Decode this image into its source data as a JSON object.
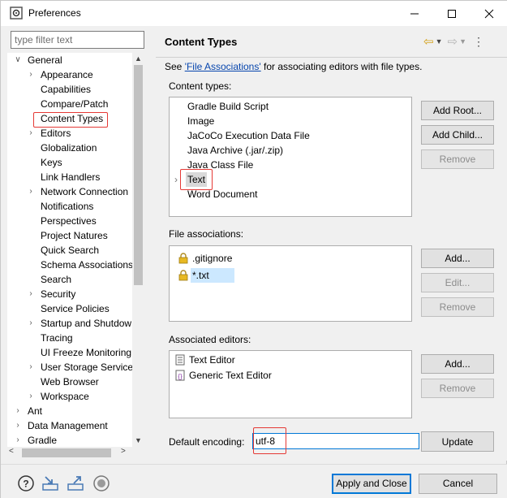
{
  "window": {
    "title": "Preferences",
    "icons": {
      "app": "gear-icon",
      "minimize": "minimize-icon",
      "maximize": "maximize-icon",
      "close": "close-icon"
    }
  },
  "filter": {
    "placeholder": "type filter text",
    "value": ""
  },
  "tree": {
    "items": [
      {
        "label": "General",
        "level": 0,
        "expanded": true,
        "has_children": true
      },
      {
        "label": "Appearance",
        "level": 1,
        "has_children": true
      },
      {
        "label": "Capabilities",
        "level": 1
      },
      {
        "label": "Compare/Patch",
        "level": 1
      },
      {
        "label": "Content Types",
        "level": 1,
        "selected": true
      },
      {
        "label": "Editors",
        "level": 1,
        "has_children": true
      },
      {
        "label": "Globalization",
        "level": 1
      },
      {
        "label": "Keys",
        "level": 1
      },
      {
        "label": "Link Handlers",
        "level": 1
      },
      {
        "label": "Network Connection",
        "level": 1,
        "has_children": true
      },
      {
        "label": "Notifications",
        "level": 1
      },
      {
        "label": "Perspectives",
        "level": 1
      },
      {
        "label": "Project Natures",
        "level": 1
      },
      {
        "label": "Quick Search",
        "level": 1
      },
      {
        "label": "Schema Associations",
        "level": 1
      },
      {
        "label": "Search",
        "level": 1
      },
      {
        "label": "Security",
        "level": 1,
        "has_children": true
      },
      {
        "label": "Service Policies",
        "level": 1
      },
      {
        "label": "Startup and Shutdow",
        "level": 1,
        "has_children": true
      },
      {
        "label": "Tracing",
        "level": 1
      },
      {
        "label": "UI Freeze Monitoring",
        "level": 1
      },
      {
        "label": "User Storage Service",
        "level": 1,
        "has_children": true
      },
      {
        "label": "Web Browser",
        "level": 1
      },
      {
        "label": "Workspace",
        "level": 1,
        "has_children": true
      },
      {
        "label": "Ant",
        "level": 0,
        "has_children": true
      },
      {
        "label": "Data Management",
        "level": 0,
        "has_children": true
      },
      {
        "label": "Gradle",
        "level": 0,
        "has_children": true
      }
    ]
  },
  "header": {
    "title": "Content Types",
    "nav_icons": [
      "back-icon",
      "back-dropdown-icon",
      "forward-icon",
      "forward-dropdown-icon",
      "menu-icon"
    ]
  },
  "intro": {
    "prefix": "See ",
    "link": "'File Associations'",
    "suffix": " for associating editors with file types."
  },
  "content_types": {
    "label": "Content types:",
    "items": [
      {
        "label": "Gradle Build Script"
      },
      {
        "label": "Image"
      },
      {
        "label": "JaCoCo Execution Data File"
      },
      {
        "label": "Java Archive (.jar/.zip)"
      },
      {
        "label": "Java Class File"
      },
      {
        "label": "Text",
        "selected": true,
        "has_children": true
      },
      {
        "label": "Word Document"
      }
    ],
    "buttons": {
      "add_root": "Add Root...",
      "add_child": "Add Child...",
      "remove": "Remove"
    }
  },
  "file_associations": {
    "label": "File associations:",
    "items": [
      {
        "label": ".gitignore",
        "icon": "lock-icon"
      },
      {
        "label": "*.txt",
        "icon": "lock-icon",
        "selected": true
      }
    ],
    "buttons": {
      "add": "Add...",
      "edit": "Edit...",
      "remove": "Remove"
    }
  },
  "associated_editors": {
    "label": "Associated editors:",
    "items": [
      {
        "label": "Text Editor",
        "icon": "text-file-icon"
      },
      {
        "label": "Generic Text Editor",
        "icon": "generic-editor-icon"
      }
    ],
    "buttons": {
      "add": "Add...",
      "remove": "Remove"
    }
  },
  "encoding": {
    "label": "Default encoding:",
    "value": "utf-8",
    "update": "Update"
  },
  "footer": {
    "icons": [
      "help-icon",
      "import-icon",
      "export-icon",
      "record-icon"
    ],
    "apply_close": "Apply and Close",
    "cancel": "Cancel"
  },
  "colors": {
    "highlight_box": "#e53935",
    "link": "#0645ad",
    "accent": "#0078d7",
    "selection": "#cce8ff"
  }
}
